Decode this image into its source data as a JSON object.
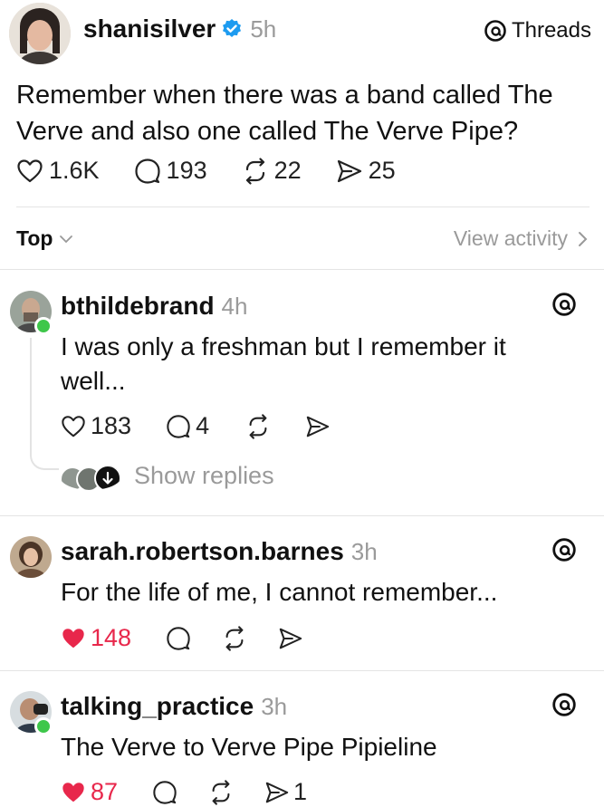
{
  "post": {
    "username": "shanisilver",
    "time": "5h",
    "app_label": "Threads",
    "text": "Remember when there was a band called The Verve and also one called The Verve Pipe?",
    "likes": "1.6K",
    "replies": "193",
    "reposts": "22",
    "shares": "25"
  },
  "sort": {
    "label": "Top",
    "activity": "View activity"
  },
  "comments": [
    {
      "username": "bthildebrand",
      "time": "4h",
      "text": "I was only a freshman but I remember it well...",
      "likes": "183",
      "replies": "4",
      "show_replies": "Show replies"
    },
    {
      "username": "sarah.robertson.barnes",
      "time": "3h",
      "text": "For the life of me, I cannot remember...",
      "likes": "148",
      "liked": true
    },
    {
      "username": "talking_practice",
      "time": "3h",
      "text": "The Verve to Verve Pipe Pipieline",
      "likes": "87",
      "shares": "1",
      "liked": true
    }
  ],
  "colors": {
    "verified": "#1d9bf0",
    "like_active": "#e8274b",
    "online": "#3ec74a"
  }
}
